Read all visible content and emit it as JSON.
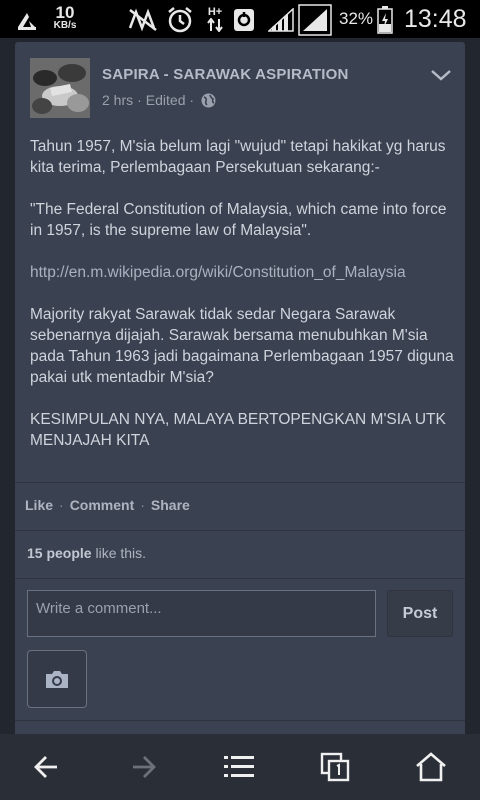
{
  "status_bar": {
    "net_speed_value": "10",
    "net_speed_unit": "KB/s",
    "network_type": "H+",
    "battery_percent": "32%",
    "time": "13:48"
  },
  "post": {
    "page_name": "SAPIRA - SARAWAK ASPIRATION",
    "time_ago": "2 hrs",
    "meta_separator": "·",
    "edited": "Edited ·",
    "paragraphs": [
      "Tahun 1957, M'sia belum lagi \"wujud\" tetapi hakikat yg harus kita terima, Perlembagaan Persekutuan sekarang:-",
      "\"The Federal Constitution of Malaysia, which came into force in 1957, is the supreme law of Malaysia\".",
      "http://en.m.wikipedia.org/wiki/Constitution_of_Malaysia",
      "Majority rakyat Sarawak tidak sedar Negara Sarawak sebenarnya dijajah. Sarawak bersama menubuhkan M'sia pada Tahun 1963 jadi bagaimana Perlembagaan 1957 diguna pakai utk mentadbir M'sia?",
      "KESIMPULAN NYA, MALAYA BERTOPENGKAN M'SIA UTK MENJAJAH KITA"
    ],
    "actions": {
      "like": "Like",
      "comment": "Comment",
      "share": "Share",
      "separator": "·"
    },
    "likes": {
      "count": "15 people",
      "suffix": " like this."
    },
    "comment_placeholder": "Write a comment...",
    "post_button": "Post"
  },
  "colors": {
    "card_bg": "#3a4150",
    "page_bg": "#22272f",
    "link": "#aab2c0"
  },
  "icons": [
    "signal-muted-icon",
    "alarm-icon",
    "data-arrows-icon",
    "sync-icon",
    "signal-icon",
    "battery-icon",
    "globe-icon",
    "chevron-down-icon",
    "camera-icon",
    "back-icon",
    "forward-icon",
    "menu-icon",
    "tabs-icon",
    "home-icon"
  ]
}
